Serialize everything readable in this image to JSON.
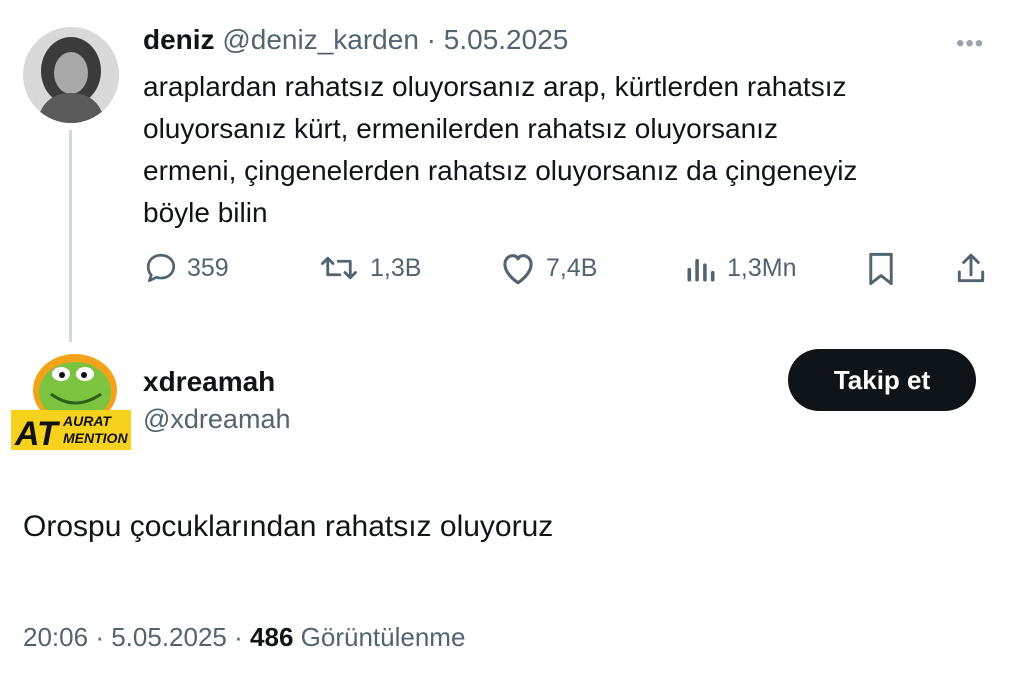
{
  "tweet": {
    "author_name": "deniz",
    "author_handle": "@deniz_karden",
    "separator": "·",
    "date": "5.05.2025",
    "more_icon": "•••",
    "text": "araplardan rahatsız oluyorsanız arap, kürtlerden rahatsız\noluyorsanız kürt, ermenilerden rahatsız oluyorsanız\nermeni, çingenelerden rahatsız oluyorsanız da çingeneyiz\nböyle bilin",
    "stats": {
      "replies": "359",
      "retweets": "1,3B",
      "likes": "7,4B",
      "views": "1,3Mn"
    }
  },
  "reply": {
    "author_name": "xdreamah",
    "author_handle": "@xdreamah",
    "follow_label": "Takip et",
    "avatar_text_top": "AURAT",
    "avatar_text_main": "AT",
    "avatar_text_bottom": "MENTION",
    "text": "Orospu çocuklarından rahatsız oluyoruz",
    "time": "20:06",
    "separator": "·",
    "date": "5.05.2025",
    "views_count": "486",
    "views_label": "Görüntülenme"
  },
  "colors": {
    "text": "#0f1419",
    "muted": "#536471",
    "thread_line": "#cfd9de",
    "button_bg": "#0f1419",
    "button_text": "#ffffff"
  },
  "icons": [
    "more-icon",
    "reply-icon",
    "retweet-icon",
    "like-icon",
    "views-icon",
    "bookmark-icon",
    "share-icon"
  ]
}
